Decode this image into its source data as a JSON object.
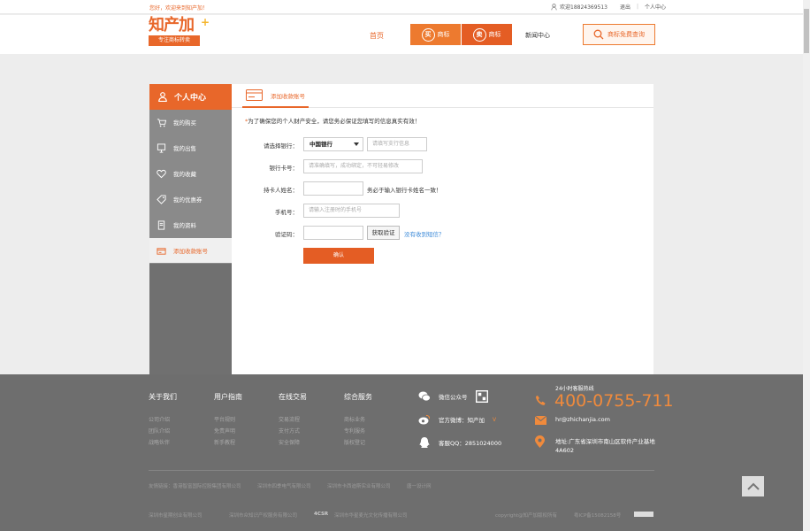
{
  "topbar": {
    "greeting": "您好，欢迎来到知产加！",
    "phone": "欢迎18824369513",
    "logout": "退出",
    "personal_center": "个人中心"
  },
  "header": {
    "logo_name": "知产加",
    "logo_plus": "+",
    "logo_slogan": "专注商标转卖",
    "nav_home": "首页",
    "buy_circle": "买",
    "buy_label": "商标",
    "sell_circle": "卖",
    "sell_label": "商标",
    "nav_news": "新闻中心",
    "consult_label": "商标免费查询"
  },
  "sidebar": {
    "title": "个人中心",
    "items": [
      {
        "label": "我的购买",
        "icon": "cart-icon"
      },
      {
        "label": "我的出售",
        "icon": "monitor-icon"
      },
      {
        "label": "我的收藏",
        "icon": "heart-icon"
      },
      {
        "label": "我的优惠券",
        "icon": "coupon-icon"
      },
      {
        "label": "我的资料",
        "icon": "document-icon"
      },
      {
        "label": "添加收款账号",
        "icon": "card-icon"
      }
    ]
  },
  "main": {
    "tab_label": "添加收款账号",
    "notice_star": "*",
    "notice": "为了确保您的个人财产安全，请您务必保证您填写的信息真实有效！",
    "form": {
      "bank_label": "请选择银行：",
      "bank_selected": "中国银行",
      "branch_placeholder": "请填写支行信息",
      "card_label": "银行卡号：",
      "card_placeholder": "请准确填写，成功绑定，不可轻易修改",
      "holder_label": "持卡人姓名：",
      "holder_hint": "务必于输入银行卡姓名一致！",
      "phone_label": "手机号：",
      "phone_placeholder": "请输入注册时的手机号",
      "code_label": "验证码：",
      "code_button": "获取验证",
      "no_sms": "没有收到短信？",
      "confirm": "确认"
    }
  },
  "footer": {
    "cols": [
      {
        "title": "关于我们",
        "links": [
          "公司介绍",
          "团队介绍",
          "战略伙伴"
        ]
      },
      {
        "title": "用户指南",
        "links": [
          "平台规则",
          "免责声明",
          "新手教程"
        ]
      },
      {
        "title": "在线交易",
        "links": [
          "交易流程",
          "支付方式",
          "安全保障"
        ]
      },
      {
        "title": "综合服务",
        "links": [
          "商标业务",
          "专利服务",
          "版权登记"
        ]
      }
    ],
    "wechat": "微信公众号",
    "weibo": "官方微博：知产加",
    "qq": "客服QQ：2851024000",
    "hotline_label": "24小时客服热线",
    "hotline": "400-0755-711",
    "email": "hr@zhichanjia.com",
    "address": "地址:广东省深圳市南山区软件产业基地4A602",
    "friend_links_1": [
      "友情链接：香港智富国际控股集团有限公司",
      "深圳市四季电气有限公司",
      "深圳市卡西迪斯实业有限公司",
      "唐一设计网"
    ],
    "friend_links_2": [
      "深圳市星期创业有限公司",
      "深圳市众知识产权服务有限公司",
      "深圳市华星麦光文化传播有限公司"
    ],
    "copyright": "copyright@知产加版权所有",
    "icp": "粤ICP备15082158号"
  }
}
